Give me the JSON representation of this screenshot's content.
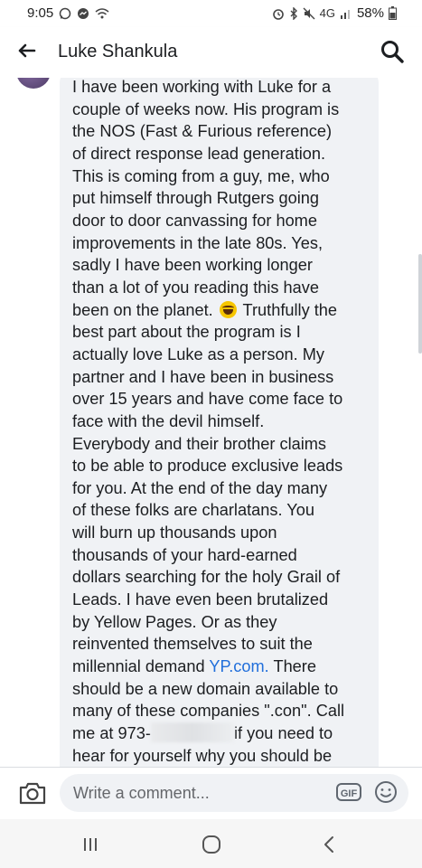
{
  "status_bar": {
    "time": "9:05",
    "network": "4G",
    "battery": "58%"
  },
  "header": {
    "title": "Luke Shankula",
    "back_icon": "arrow-left-icon",
    "search_icon": "search-icon"
  },
  "comment": {
    "lines": [
      "I have been working with Luke for a",
      "couple of weeks now. His program is",
      "the NOS (Fast & Furious reference)",
      "of direct response lead generation.",
      "This is coming from a guy, me, who",
      "put himself through Rutgers going",
      "door to door canvassing for home",
      "improvements in the late 80s. Yes,",
      "sadly I have been working longer",
      "than a lot of you reading this have",
      "been on the planet.",
      "Truthfully the",
      "best part about the program is I",
      "actually love Luke as a person. My",
      "partner and I have been in business",
      "over 15 years and have come face to",
      "face with the devil himself.",
      "Everybody and their brother claims",
      "to be able to produce exclusive leads",
      "for you. At the end of the day many",
      "of these folks are charlatans. You",
      "will burn up thousands upon",
      "thousands of your hard-earned",
      "dollars searching for the holy Grail of",
      "Leads. I have even been brutalized",
      "by Yellow Pages. Or as they",
      "reinvented themselves to suit the",
      "millennial demand",
      "YP.com.",
      "There",
      "should be a new domain available to",
      "many of these companies \".con\". Call",
      "me at 973-",
      "if you need to",
      "hear for yourself why you should be"
    ],
    "emoji_icon": "laughing-emoji-icon"
  },
  "composer": {
    "placeholder": "Write a comment...",
    "gif_label": "GIF",
    "camera_icon": "camera-icon",
    "emoji_icon": "smiley-icon"
  },
  "navbar": {
    "recent_icon": "recent-apps-icon",
    "home_icon": "home-icon",
    "back_icon": "back-icon"
  },
  "colors": {
    "link": "#216fdb",
    "bubble": "#f0f2f5",
    "text": "#1c1e21"
  }
}
